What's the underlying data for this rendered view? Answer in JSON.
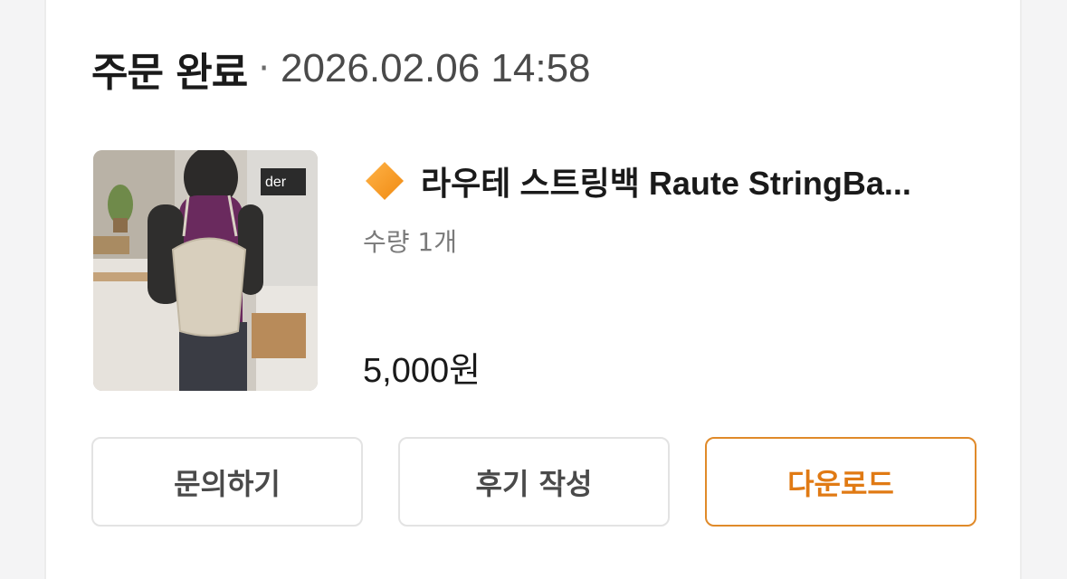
{
  "order": {
    "status": "주문 완료",
    "separator": "·",
    "date": "2026.02.06 14:58"
  },
  "product": {
    "icon": "orange-diamond-icon",
    "title": "라우테 스트링백 Raute StringBa...",
    "quantity": "수량 1개",
    "price": "5,000원",
    "image": "product-photo-person-with-string-bag"
  },
  "actions": {
    "inquiry": "문의하기",
    "review": "후기 작성",
    "download": "다운로드"
  },
  "colors": {
    "accent": "#e07a14",
    "diamond": "#f59a23"
  }
}
